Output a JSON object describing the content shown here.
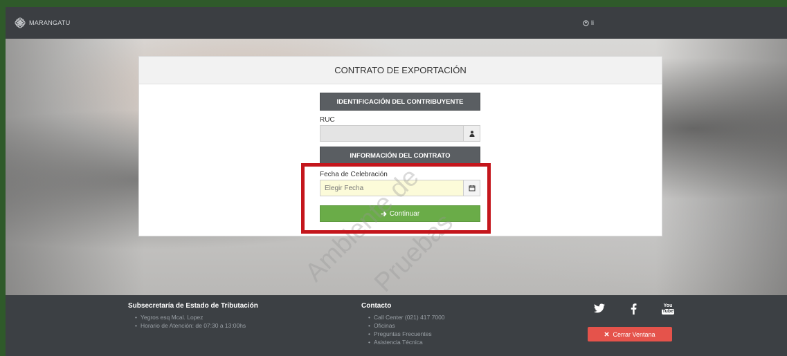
{
  "brand": {
    "name": "MARANGATU",
    "logo_icon": "flower-logo-icon"
  },
  "user": {
    "icon": "user-circle-icon",
    "name": "li"
  },
  "form": {
    "title": "CONTRATO DE EXPORTACIÓN",
    "section_identificacion": "IDENTIFICACIÓN DEL CONTRIBUYENTE",
    "ruc_label": "RUC",
    "ruc_value": "",
    "section_contrato": "INFORMACIÓN DEL CONTRATO",
    "fecha_label": "Fecha de Celebración",
    "fecha_placeholder": "Elegir Fecha",
    "continue_label": "Continuar"
  },
  "watermark": {
    "line1": "Ambiente de",
    "line2": "Pruebas"
  },
  "footer": {
    "sub_title": "Subsecretaría de Estado de Tributación",
    "sub_items": [
      "Yegros esq Mcal. Lopez",
      "Horario de Atención: de 07:30 a 13:00hs"
    ],
    "contact_title": "Contacto",
    "contact_items": [
      "Call Center (021) 417 7000",
      "Oficinas",
      "Preguntas Frecuentes",
      "Asistencia Técnica"
    ],
    "social": [
      "twitter-icon",
      "facebook-icon",
      "youtube-icon"
    ],
    "youtube_text": {
      "top": "You",
      "bottom": "Tube"
    },
    "close_label": "Cerrar Ventana"
  },
  "colors": {
    "accent_green": "#6aac48",
    "danger_red": "#e5534b",
    "highlight_red": "#c4161c",
    "section_gray": "#5a5e62",
    "date_field_bg": "#fcfbd9"
  }
}
